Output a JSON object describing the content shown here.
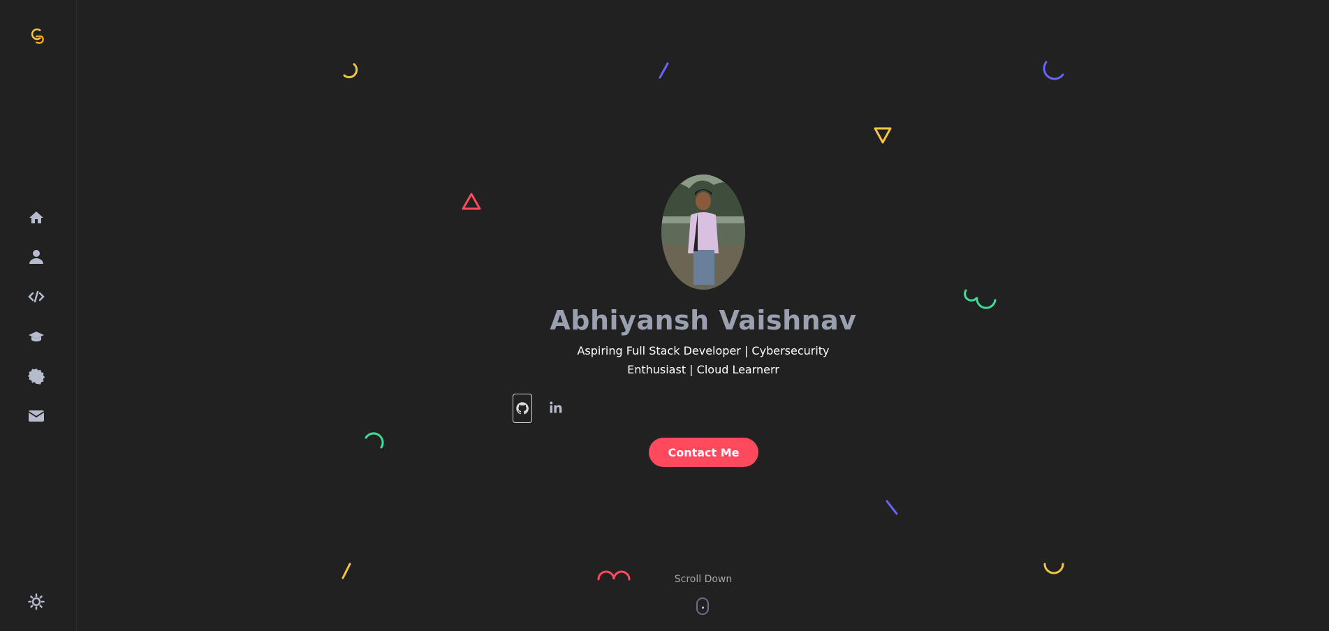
{
  "sidebar": {
    "logo_icon": "brand-logo-icon",
    "items": [
      {
        "icon": "home-icon",
        "label": "Home"
      },
      {
        "icon": "user-icon",
        "label": "About"
      },
      {
        "icon": "code-icon",
        "label": "Projects"
      },
      {
        "icon": "graduation-cap-icon",
        "label": "Education"
      },
      {
        "icon": "certificate-icon",
        "label": "Certificates"
      },
      {
        "icon": "envelope-icon",
        "label": "Contact"
      }
    ],
    "theme_toggle_icon": "sun-icon"
  },
  "hero": {
    "name": "Abhiyansh Vaishnav",
    "tagline": "Aspiring Full Stack Developer | Cybersecurity Enthusiast | Cloud Learnerr",
    "social": [
      {
        "icon": "github-icon",
        "label": "GitHub"
      },
      {
        "icon": "linkedin-icon",
        "label": "LinkedIn"
      }
    ],
    "contact_button": "Contact Me",
    "scroll_text": "Scroll Down"
  },
  "colors": {
    "background": "#212121",
    "accent_red": "#ff4a5e",
    "accent_yellow": "#f5c542",
    "accent_purple": "#6c63ff",
    "accent_teal": "#3ddc97",
    "name_gray": "#9ba0b0"
  }
}
